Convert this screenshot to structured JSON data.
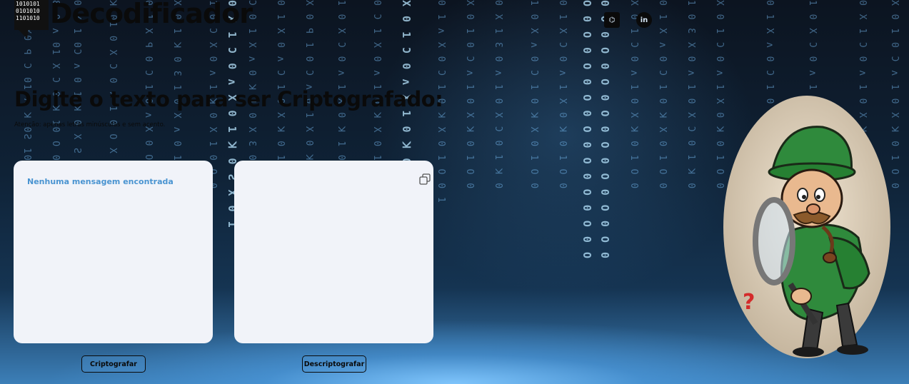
{
  "header": {
    "brand": "Decodificador",
    "logo_bits": "1010101 0101010 1101010",
    "social": [
      {
        "name": "github",
        "glyph": "⌬"
      },
      {
        "name": "linkedin",
        "glyph": "in"
      }
    ]
  },
  "main": {
    "title": "Digite o texto para ser Criptografado:",
    "hint": "Atenção: apenas letras minúsculas e sem acento."
  },
  "input_panel": {
    "placeholder": "Nenhuma mensagem encontrada"
  },
  "output_panel": {
    "copy_icon": "copy-icon"
  },
  "buttons": {
    "encrypt": "Criptografar",
    "decrypt": "Descriptografar"
  },
  "illustration": {
    "subject": "detective with magnifying glass",
    "mark": "?"
  },
  "colors": {
    "panel_bg": "#f1f3f9",
    "placeholder": "#4a94d1",
    "accent_blue": "#7fc6ff"
  }
}
